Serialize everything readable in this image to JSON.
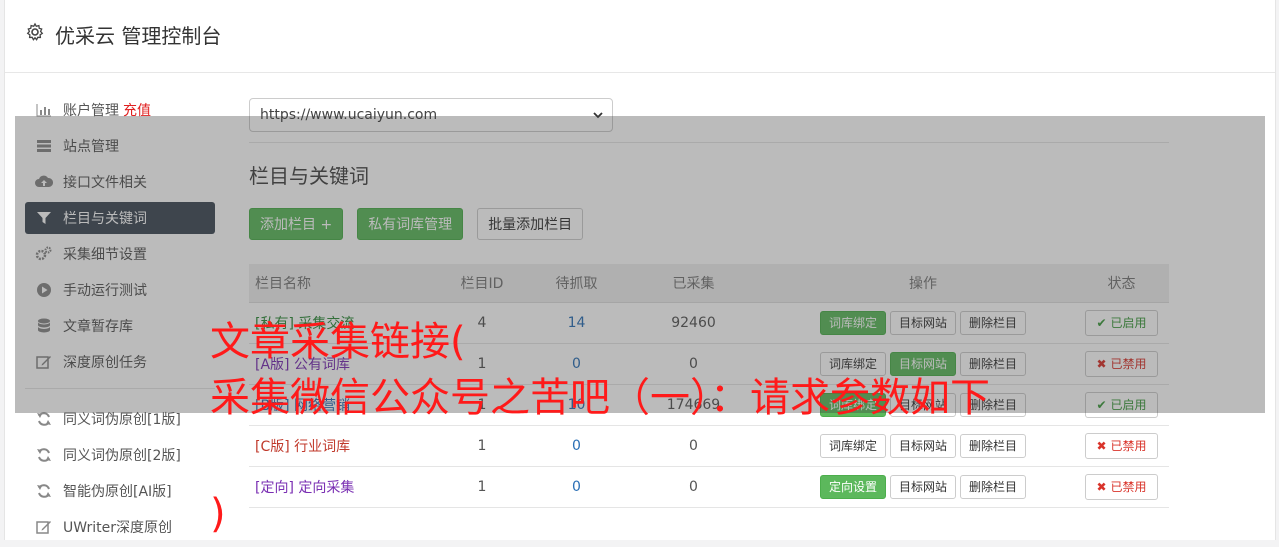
{
  "header": {
    "title": "优采云 管理控制台",
    "icon": "gear-icon"
  },
  "sidebar": {
    "items": [
      {
        "label": "账户管理",
        "extra": "充值",
        "icon": "bar-chart-icon",
        "active": false
      },
      {
        "label": "站点管理",
        "icon": "server-icon",
        "active": false
      },
      {
        "label": "接口文件相关",
        "icon": "cloud-upload-icon",
        "active": false
      },
      {
        "label": "栏目与关键词",
        "icon": "filter-icon",
        "active": true
      },
      {
        "label": "采集细节设置",
        "icon": "cogs-icon",
        "active": false
      },
      {
        "label": "手动运行测试",
        "icon": "play-circle-icon",
        "active": false
      },
      {
        "label": "文章暂存库",
        "icon": "database-icon",
        "active": false
      },
      {
        "label": "深度原创任务",
        "icon": "edit-icon",
        "active": false
      }
    ],
    "tools": [
      {
        "label": "同义词伪原创[1版]",
        "icon": "refresh-icon"
      },
      {
        "label": "同义词伪原创[2版]",
        "icon": "refresh-icon"
      },
      {
        "label": "智能伪原创[AI版]",
        "icon": "refresh-icon"
      },
      {
        "label": "UWriter深度原创",
        "icon": "edit-icon"
      }
    ]
  },
  "main": {
    "site_select": "https://www.ucaiyun.com",
    "section_title": "栏目与关键词",
    "buttons": {
      "add": "添加栏目 +",
      "private_lib": "私有词库管理",
      "batch_add": "批量添加栏目"
    },
    "table": {
      "headers": [
        "栏目名称",
        "栏目ID",
        "待抓取",
        "已采集",
        "操作",
        "状态"
      ],
      "rows": [
        {
          "tag": "[私有]",
          "name": "采集交流",
          "id": "4",
          "pending": "14",
          "collected": "92460",
          "op1": "词库绑定",
          "op2": "目标网站",
          "op3": "删除栏目",
          "status": "已启用",
          "status_on": true
        },
        {
          "tag": "[A版]",
          "name": "公有词库",
          "id": "1",
          "pending": "0",
          "collected": "0",
          "op1": "词库绑定",
          "op2": "目标网站",
          "op3": "删除栏目",
          "status": "已禁用",
          "status_on": false
        },
        {
          "tag": "[B版]",
          "name": "网络营销",
          "id": "1",
          "pending": "10",
          "collected": "174669",
          "op1": "词库绑定",
          "op2": "目标网站",
          "op3": "删除栏目",
          "status": "已启用",
          "status_on": true
        },
        {
          "tag": "[C版]",
          "name": "行业词库",
          "id": "1",
          "pending": "0",
          "collected": "0",
          "op1": "词库绑定",
          "op2": "目标网站",
          "op3": "删除栏目",
          "status": "已禁用",
          "status_on": false
        },
        {
          "tag": "[定向]",
          "name": "定向采集",
          "id": "1",
          "pending": "0",
          "collected": "0",
          "op1": "定向设置",
          "op2": "目标网站",
          "op3": "删除栏目",
          "status": "已禁用",
          "status_on": false
        }
      ]
    }
  },
  "overlay": {
    "line1": "文章采集链接(",
    "line2": "采集微信公众号之苦吧（一）：请求参数如下",
    "line3": ")"
  },
  "colors": {
    "accent_green": "#5cb85c",
    "sidebar_active": "#3f4a57",
    "overlay_text": "#ff1a1a"
  }
}
